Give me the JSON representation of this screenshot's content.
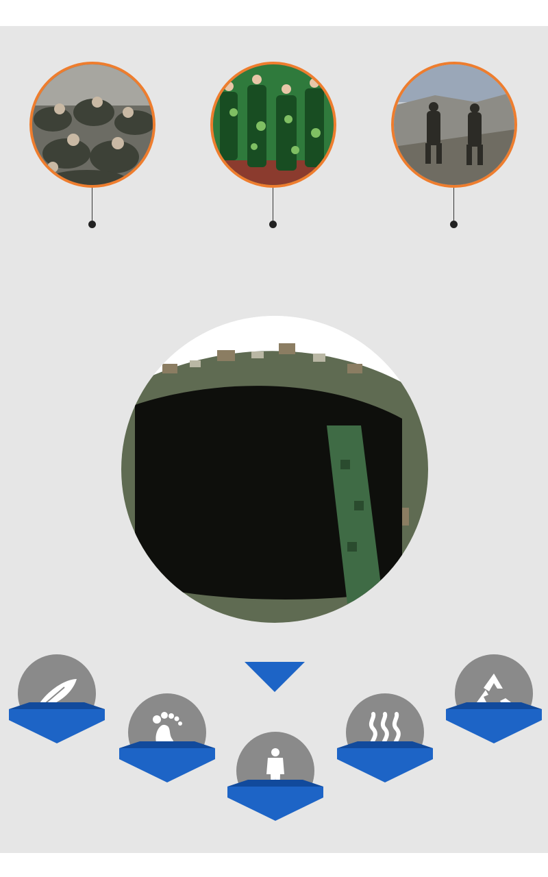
{
  "scenes": [
    {
      "name": "training-scene",
      "icon": "soldiers-resting-photo"
    },
    {
      "name": "parade-scene",
      "icon": "camouflage-march-photo"
    },
    {
      "name": "hiking-scene",
      "icon": "mountain-hikers-photo"
    }
  ],
  "detail": {
    "icon": "camouflage-insole-closeup-photo"
  },
  "features": [
    {
      "name": "lightweight",
      "icon": "feather-icon",
      "caption": ""
    },
    {
      "name": "comfort-fit",
      "icon": "footprint-icon",
      "caption": ""
    },
    {
      "name": "body-support",
      "icon": "human-figure-icon",
      "caption": ""
    },
    {
      "name": "breathable",
      "icon": "heat-waves-icon",
      "caption": ""
    },
    {
      "name": "eco-friendly",
      "icon": "recycle-icon",
      "caption": ""
    }
  ],
  "colors": {
    "accent_orange": "#ee7d2e",
    "feature_blue": "#1d64c6",
    "feature_blue_dark": "#114a9c",
    "disc_gray": "#8a8a8a",
    "panel_gray": "#e6e6e6"
  }
}
